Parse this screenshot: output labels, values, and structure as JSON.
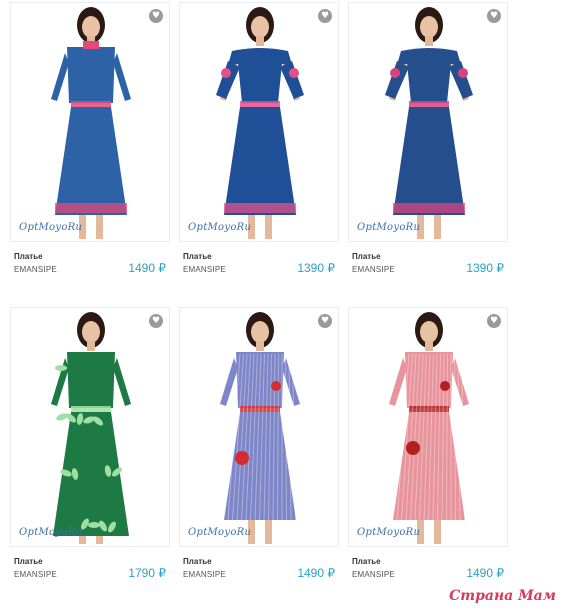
{
  "products": [
    {
      "title": "Платье",
      "brand": "EMANSIPE",
      "price": "1490 ₽",
      "mark": "OptMoyoRu",
      "dress_color": "#2d62a6",
      "print": "#e24a7a"
    },
    {
      "title": "Платье",
      "brand": "EMANSIPE",
      "price": "1390 ₽",
      "mark": "OptMoyoRu",
      "dress_color": "#1f4f96",
      "print": "#e2508a"
    },
    {
      "title": "Платье",
      "brand": "EMANSIPE",
      "price": "1390 ₽",
      "mark": "OptMoyoRu",
      "dress_color": "#244f8c",
      "print": "#d8437f"
    },
    {
      "title": "Платье",
      "brand": "EMANSIPE",
      "price": "1790 ₽",
      "mark": "OptMoyoRu",
      "dress_color": "#1e7a44",
      "print": "#9fe0a2"
    },
    {
      "title": "Платье",
      "brand": "EMANSIPE",
      "price": "1490 ₽",
      "mark": "OptMoyoRu",
      "dress_color": "#7e86c8",
      "print": "#d32d2d"
    },
    {
      "title": "Платье",
      "brand": "EMANSIPE",
      "price": "1490 ₽",
      "mark": "OptMoyoRu",
      "dress_color": "#e8949c",
      "print": "#b32020"
    }
  ],
  "watermark": "Страна Мам",
  "fav_icon": "heart-icon"
}
